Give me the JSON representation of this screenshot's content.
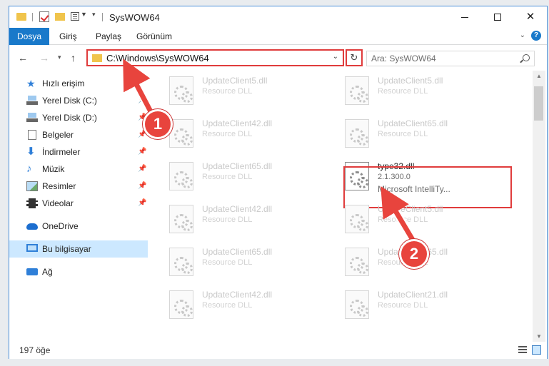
{
  "window": {
    "title": "SysWOW64"
  },
  "ribbon": {
    "tabs": [
      "Dosya",
      "Giriş",
      "Paylaş",
      "Görünüm"
    ]
  },
  "address": {
    "path": "C:\\Windows\\SysWOW64",
    "search_placeholder": "Ara: SysWOW64"
  },
  "sidebar": {
    "items": [
      {
        "label": "Hızlı erişim",
        "icon": "star-icon"
      },
      {
        "label": "Yerel Disk (C:)",
        "icon": "drive-icon"
      },
      {
        "label": "Yerel Disk (D:)",
        "icon": "drive-icon"
      },
      {
        "label": "Belgeler",
        "icon": "document-icon"
      },
      {
        "label": "İndirmeler",
        "icon": "download-icon"
      },
      {
        "label": "Müzik",
        "icon": "music-icon"
      },
      {
        "label": "Resimler",
        "icon": "pictures-icon"
      },
      {
        "label": "Videolar",
        "icon": "video-icon"
      },
      {
        "label": "OneDrive",
        "icon": "cloud-icon"
      },
      {
        "label": "Bu bilgisayar",
        "icon": "computer-icon"
      },
      {
        "label": "Ağ",
        "icon": "network-icon"
      }
    ]
  },
  "files": [
    {
      "name": "UpdateClient5.dll",
      "desc": "Resource DLL"
    },
    {
      "name": "UpdateClient5.dll",
      "desc": "Resource DLL"
    },
    {
      "name": "UpdateClient42.dll",
      "desc": "Resource DLL"
    },
    {
      "name": "UpdateClient65.dll",
      "desc": "Resource DLL"
    },
    {
      "name": "UpdateClient65.dll",
      "desc": "Resource DLL"
    },
    {
      "name": "type32.dll",
      "desc": "2.1.300.0",
      "desc2": "Microsoft IntelliTy..."
    },
    {
      "name": "UpdateClient42.dll",
      "desc": "Resource DLL"
    },
    {
      "name": "UpdateClient5.dll",
      "desc": "Resource DLL"
    },
    {
      "name": "UpdateClient65.dll",
      "desc": "Resource DLL"
    },
    {
      "name": "UpdateClient65.dll",
      "desc": "Resource DLL"
    },
    {
      "name": "UpdateClient42.dll",
      "desc": "Resource DLL"
    },
    {
      "name": "UpdateClient21.dll",
      "desc": "Resource DLL"
    }
  ],
  "status": {
    "count": "197 öğe"
  },
  "annotations": {
    "step1": "1",
    "step2": "2",
    "color": "#e8443d"
  }
}
